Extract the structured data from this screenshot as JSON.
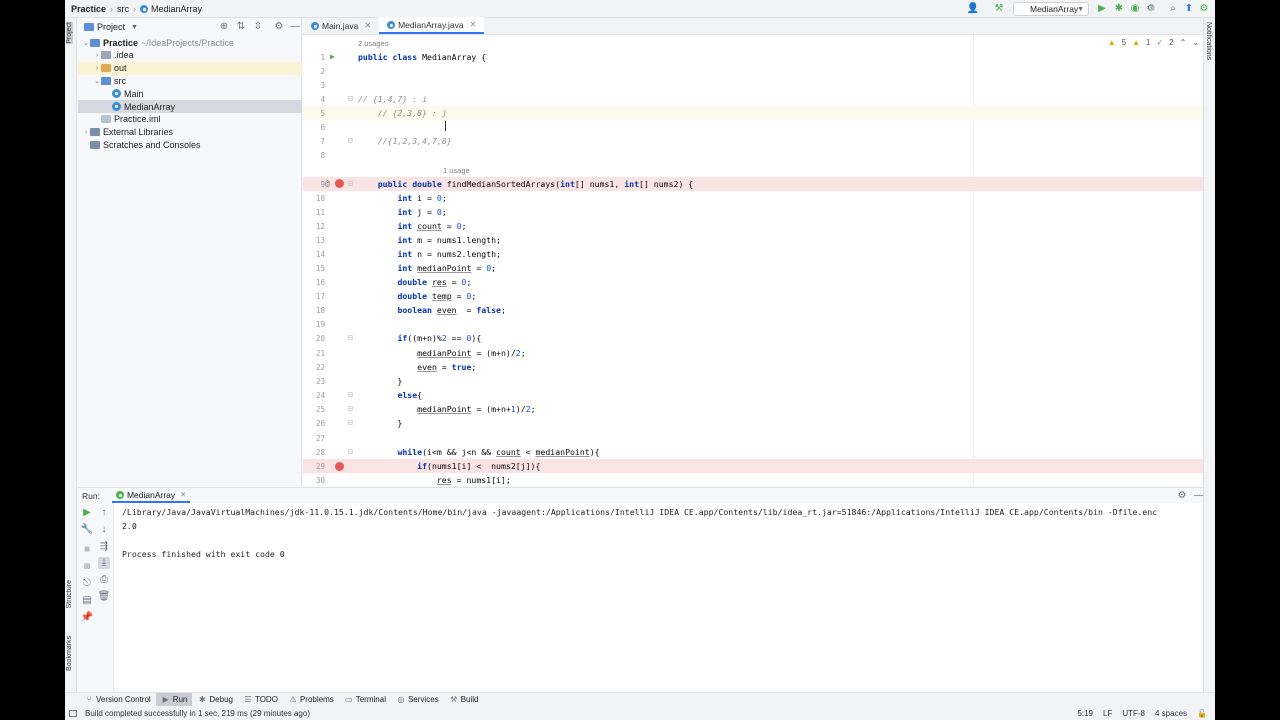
{
  "breadcrumb": [
    "Practice",
    "src",
    "MedianArray"
  ],
  "run_config": "MedianArray",
  "project_panel": {
    "title": "Project",
    "tree": [
      {
        "label": "Practice",
        "extra": "~/IdeaProjects/Practice",
        "type": "folder-blue",
        "depth": 0,
        "arrow": "open"
      },
      {
        "label": ".idea",
        "type": "folder",
        "depth": 1,
        "arrow": "closed"
      },
      {
        "label": "out",
        "type": "folder-orange",
        "depth": 1,
        "arrow": "closed"
      },
      {
        "label": "src",
        "type": "folder-blue",
        "depth": 1,
        "arrow": "open"
      },
      {
        "label": "Main",
        "type": "java",
        "depth": 2,
        "arrow": ""
      },
      {
        "label": "MedianArray",
        "type": "java",
        "depth": 2,
        "arrow": "",
        "selected": true
      },
      {
        "label": "Practice.iml",
        "type": "file",
        "depth": 1,
        "arrow": ""
      },
      {
        "label": "External Libraries",
        "type": "lib",
        "depth": 0,
        "arrow": "closed"
      },
      {
        "label": "Scratches and Consoles",
        "type": "scratch",
        "depth": 0,
        "arrow": ""
      }
    ]
  },
  "editor": {
    "tabs": [
      {
        "label": "Main.java",
        "active": false
      },
      {
        "label": "MedianArray.java",
        "active": true
      }
    ],
    "inspections": {
      "warnings": "5",
      "weak": "1",
      "typos": "2"
    },
    "usages_top": "2 usages",
    "usages_method": "1 usage",
    "lines": [
      {
        "n": "1",
        "html": "<span class='kw'>public class</span> MedianArray {"
      },
      {
        "n": "2",
        "html": ""
      },
      {
        "n": "3",
        "html": ""
      },
      {
        "n": "4",
        "html": "<span class='cm'>// {1,4,7} : i</span>"
      },
      {
        "n": "5",
        "html": "    <span class='cm'>// {2,3,8} : j</span>"
      },
      {
        "n": "6",
        "html": ""
      },
      {
        "n": "7",
        "html": "    <span class='cm'>//{1,2,3,4,7,8}</span>"
      },
      {
        "n": "8",
        "html": ""
      },
      {
        "n": "9",
        "html": "    <span class='kw'>public double</span> findMedianSortedArrays(<span class='kw'>int</span>[] nums1, <span class='kw'>int</span>[] nums2) {"
      },
      {
        "n": "10",
        "html": "        <span class='kw'>int</span> i = <span class='num'>0</span>;"
      },
      {
        "n": "11",
        "html": "        <span class='kw'>int</span> j = <span class='num'>0</span>;"
      },
      {
        "n": "12",
        "html": "        <span class='kw'>int</span> <span class='ul'>count</span> = <span class='num'>0</span>;"
      },
      {
        "n": "13",
        "html": "        <span class='kw'>int</span> m = nums1.length;"
      },
      {
        "n": "14",
        "html": "        <span class='kw'>int</span> n = nums2.length;"
      },
      {
        "n": "15",
        "html": "        <span class='kw'>int</span> <span class='ul'>medianPoint</span> = <span class='num'>0</span>;"
      },
      {
        "n": "16",
        "html": "        <span class='kw'>double</span> <span class='ul'>res</span> = <span class='num'>0</span>;"
      },
      {
        "n": "17",
        "html": "        <span class='kw'>double</span> <span class='ul'>temp</span> = <span class='num'>0</span>;"
      },
      {
        "n": "18",
        "html": "        <span class='kw'>boolean</span> <span class='ul'>even</span>  = <span class='kw'>false</span>;"
      },
      {
        "n": "19",
        "html": ""
      },
      {
        "n": "20",
        "html": "        <span class='kw'>if</span>((m+n)%<span class='num'>2</span> == <span class='num'>0</span>){"
      },
      {
        "n": "21",
        "html": "            <span class='ul'>medianPoint</span> = (m+n)/<span class='num'>2</span>;"
      },
      {
        "n": "22",
        "html": "            <span class='ul'>even</span> = <span class='kw'>true</span>;"
      },
      {
        "n": "23",
        "html": "        }"
      },
      {
        "n": "24",
        "html": "        <span class='kw'>else</span>{"
      },
      {
        "n": "25",
        "html": "            <span class='ul'>medianPoint</span> = (m+n+<span class='num'>1</span>)/<span class='num'>2</span>;"
      },
      {
        "n": "26",
        "html": "        }"
      },
      {
        "n": "27",
        "html": ""
      },
      {
        "n": "28",
        "html": "        <span class='kw'>while</span>(i&lt;m &amp;&amp; j&lt;n &amp;&amp; <span class='ul'>count</span> &lt; <span class='ul'>medianPoint</span>){"
      },
      {
        "n": "29",
        "html": "            <span class='kw'>if</span>(nums1[i] &lt;  nums2[j]){"
      },
      {
        "n": "30",
        "html": "                <span class='ul'>res</span> = nums1[i];"
      }
    ]
  },
  "run_panel": {
    "label": "Run:",
    "tab": "MedianArray",
    "output": [
      "/Library/Java/JavaVirtualMachines/jdk-11.0.15.1.jdk/Contents/Home/bin/java -javaagent:/Applications/IntelliJ IDEA CE.app/Contents/lib/idea_rt.jar=51846:/Applications/IntelliJ IDEA CE.app/Contents/bin -Dfile.enc",
      "2.0",
      "",
      "Process finished with exit code 0"
    ]
  },
  "side_labels": {
    "project": "Project",
    "structure": "Structure",
    "bookmarks": "Bookmarks",
    "notifications": "Notifications"
  },
  "bottom_tools": [
    {
      "label": "Version Control",
      "icon": "branch-icon"
    },
    {
      "label": "Run",
      "icon": "play-icon",
      "active": true
    },
    {
      "label": "Debug",
      "icon": "bug-icon"
    },
    {
      "label": "TODO",
      "icon": "list-icon"
    },
    {
      "label": "Problems",
      "icon": "warning-icon"
    },
    {
      "label": "Terminal",
      "icon": "terminal-icon"
    },
    {
      "label": "Services",
      "icon": "services-icon"
    },
    {
      "label": "Build",
      "icon": "hammer-icon"
    }
  ],
  "status": {
    "message": "Build completed successfully in 1 sec, 219 ms (29 minutes ago)",
    "position": "5:19",
    "line_sep": "LF",
    "encoding": "UTF-8",
    "indent": "4 spaces"
  },
  "colors": {
    "accent": "#3574f0",
    "breakpoint": "#e55757",
    "run_green": "#4caf50"
  }
}
